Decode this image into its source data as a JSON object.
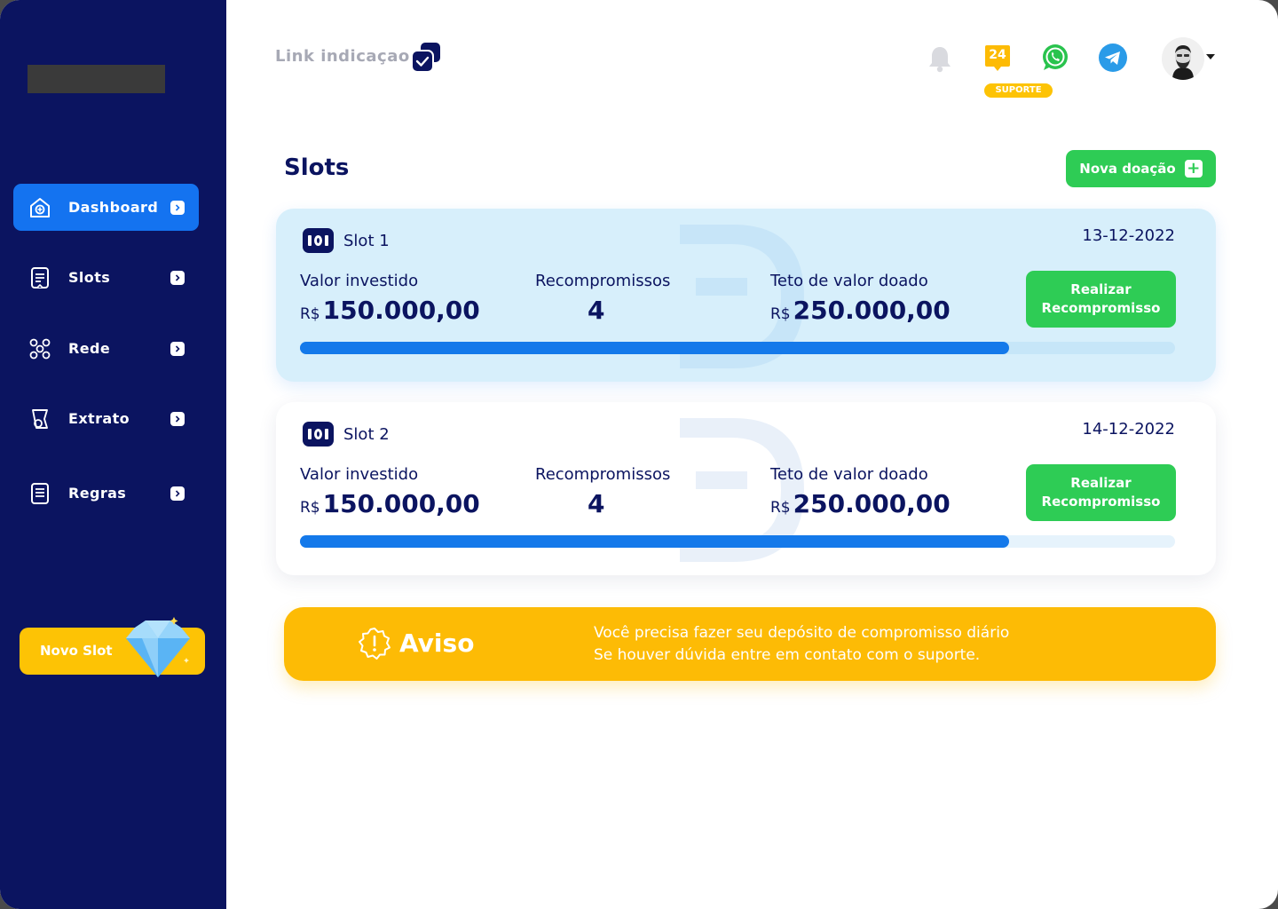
{
  "sidebar": {
    "items": [
      {
        "label": "Dashboard",
        "icon": "home-icon",
        "active": true
      },
      {
        "label": "Slots",
        "icon": "document-icon"
      },
      {
        "label": "Rede",
        "icon": "network-icon"
      },
      {
        "label": "Extrato",
        "icon": "statement-icon"
      },
      {
        "label": "Regras",
        "icon": "rules-icon"
      }
    ],
    "novo_slot_label": "Novo Slot"
  },
  "topbar": {
    "link_label": "Link indicaçao",
    "support_hours": "24",
    "support_label": "SUPORTE"
  },
  "main": {
    "title": "Slots",
    "new_button_label": "Nova doação",
    "plus_symbol": "+"
  },
  "slots": [
    {
      "name": "Slot 1",
      "date": "13-12-2022",
      "invested_label": "Valor investido",
      "invested_currency": "R$",
      "invested_value": "150.000,00",
      "recommit_label": "Recompromissos",
      "recommit_value": "4",
      "cap_label": "Teto de valor doado",
      "cap_currency": "R$",
      "cap_value": "250.000,00",
      "action_line1": "Realizar",
      "action_line2": "Recompromisso",
      "progress": 0.81
    },
    {
      "name": "Slot 2",
      "date": "14-12-2022",
      "invested_label": "Valor investido",
      "invested_currency": "R$",
      "invested_value": "150.000,00",
      "recommit_label": "Recompromissos",
      "recommit_value": "4",
      "cap_label": "Teto de valor doado",
      "cap_currency": "R$",
      "cap_value": "250.000,00",
      "action_line1": "Realizar",
      "action_line2": "Recompromisso",
      "progress": 0.81
    }
  ],
  "aviso": {
    "title": "Aviso",
    "line1": "Você precisa fazer seu depósito de compromisso diário",
    "line2": "Se houver dúvida entre em contato com o suporte."
  },
  "colors": {
    "sidebar_bg": "#0b1460",
    "active": "#1473f0",
    "green": "#2ecc55",
    "yellow": "#fdbb05",
    "progress": "#1479ea"
  }
}
